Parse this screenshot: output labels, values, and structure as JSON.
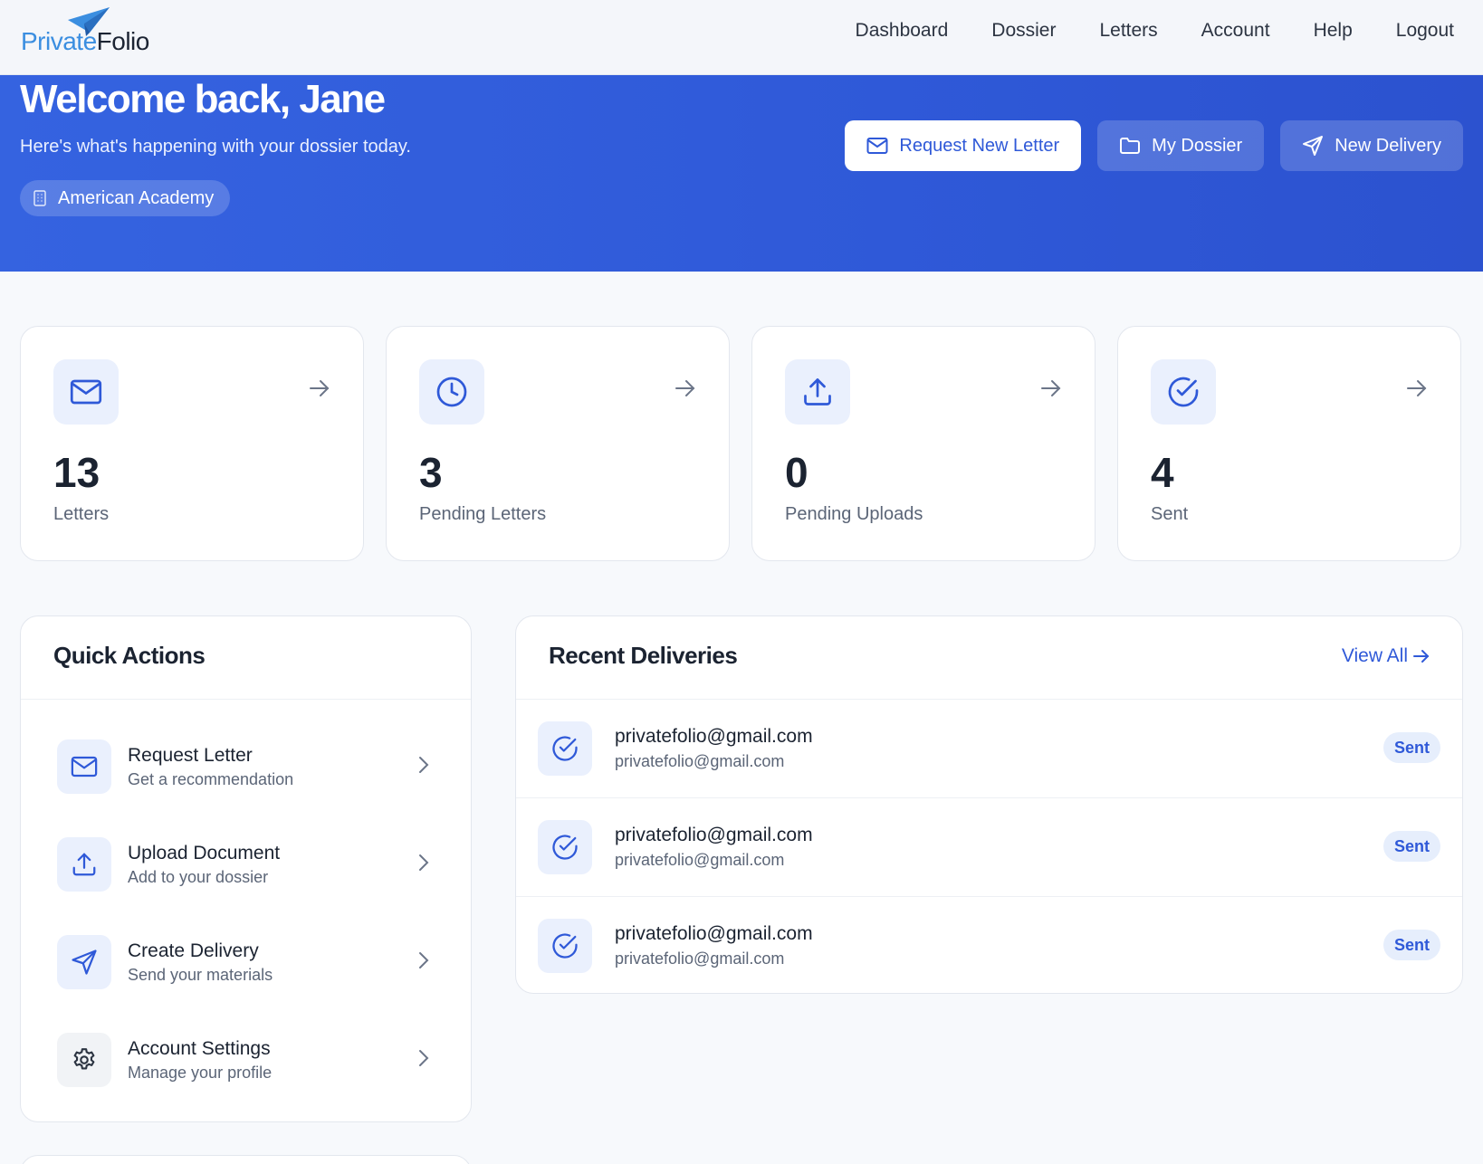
{
  "app": {
    "logo_part1": "Private",
    "logo_part2": "Folio"
  },
  "nav": {
    "links": [
      "Dashboard",
      "Dossier",
      "Letters",
      "Account",
      "Help",
      "Logout"
    ]
  },
  "hero": {
    "title": "Welcome back, Jane",
    "subtitle": "Here's what's happening with your dossier today.",
    "org": "American Academy",
    "buttons": {
      "request": "Request New Letter",
      "dossier": "My Dossier",
      "delivery": "New Delivery"
    }
  },
  "stats": [
    {
      "icon": "mail-icon",
      "value": "13",
      "label": "Letters"
    },
    {
      "icon": "clock-icon",
      "value": "3",
      "label": "Pending Letters"
    },
    {
      "icon": "upload-icon",
      "value": "0",
      "label": "Pending Uploads"
    },
    {
      "icon": "check-circle-icon",
      "value": "4",
      "label": "Sent"
    }
  ],
  "quick_actions": {
    "title": "Quick Actions",
    "items": [
      {
        "icon": "mail-icon",
        "title": "Request Letter",
        "desc": "Get a recommendation"
      },
      {
        "icon": "upload-icon",
        "title": "Upload Document",
        "desc": "Add to your dossier"
      },
      {
        "icon": "send-icon",
        "title": "Create Delivery",
        "desc": "Send your materials"
      },
      {
        "icon": "gear-icon",
        "title": "Account Settings",
        "desc": "Manage your profile"
      }
    ]
  },
  "recent_deliveries": {
    "title": "Recent Deliveries",
    "view_all": "View All",
    "rows": [
      {
        "main": "privatefolio@gmail.com",
        "sub": "privatefolio@gmail.com",
        "status": "Sent"
      },
      {
        "main": "privatefolio@gmail.com",
        "sub": "privatefolio@gmail.com",
        "status": "Sent"
      },
      {
        "main": "privatefolio@gmail.com",
        "sub": "privatefolio@gmail.com",
        "status": "Sent"
      }
    ]
  },
  "colors": {
    "brand": "#2f59d8",
    "logo_blue": "#3b8ee0",
    "icon_bg": "#eaf0fd"
  }
}
